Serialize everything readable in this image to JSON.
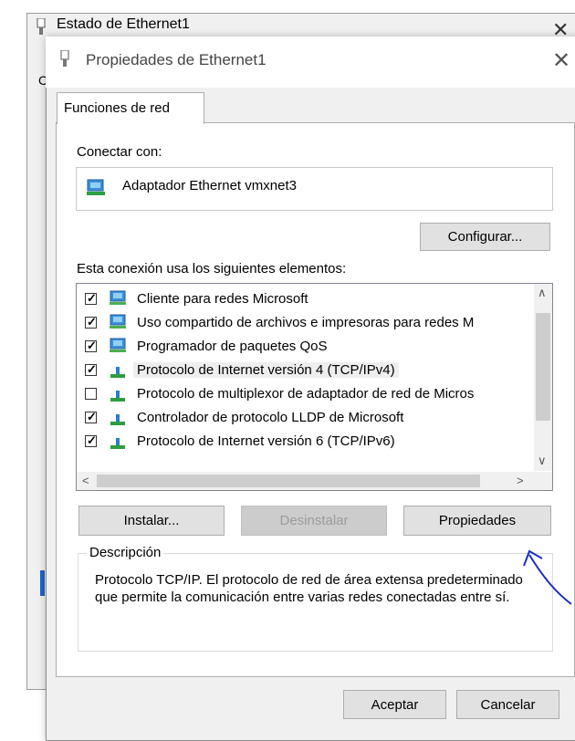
{
  "background_window": {
    "title": "Estado de Ethernet1",
    "close_glyph": "✕",
    "partial_text": "C"
  },
  "dialog": {
    "title": "Propiedades de Ethernet1",
    "close_glyph": "✕",
    "tab": "Funciones de red",
    "connect_label": "Conectar con:",
    "adapter_name": "Adaptador Ethernet vmxnet3",
    "configure_button": "Configurar...",
    "elements_label": "Esta conexión usa los siguientes elementos:",
    "items": [
      {
        "label": "Cliente para redes Microsoft",
        "checked": true,
        "icon": "network-client-icon"
      },
      {
        "label": "Uso compartido de archivos e impresoras para redes M",
        "checked": true,
        "icon": "file-sharing-service-icon"
      },
      {
        "label": "Programador de paquetes QoS",
        "checked": true,
        "icon": "qos-service-icon"
      },
      {
        "label": "Protocolo de Internet versión 4 (TCP/IPv4)",
        "checked": true,
        "icon": "protocol-icon",
        "selected": true
      },
      {
        "label": "Protocolo de multiplexor de adaptador de red de Micros",
        "checked": false,
        "icon": "protocol-icon"
      },
      {
        "label": "Controlador de protocolo LLDP de Microsoft",
        "checked": true,
        "icon": "protocol-icon"
      },
      {
        "label": "Protocolo de Internet versión 6 (TCP/IPv6)",
        "checked": true,
        "icon": "protocol-icon"
      }
    ],
    "install_button": "Instalar...",
    "uninstall_button": "Desinstalar",
    "properties_button": "Propiedades",
    "description_legend": "Descripción",
    "description_text": "Protocolo TCP/IP. El protocolo de red de área extensa predeterminado que permite la comunicación entre varias redes conectadas entre sí.",
    "accept_button": "Aceptar",
    "cancel_button": "Cancelar"
  },
  "colors": {
    "annotation": "#1c2fbf",
    "selection": "#eeeeee"
  }
}
